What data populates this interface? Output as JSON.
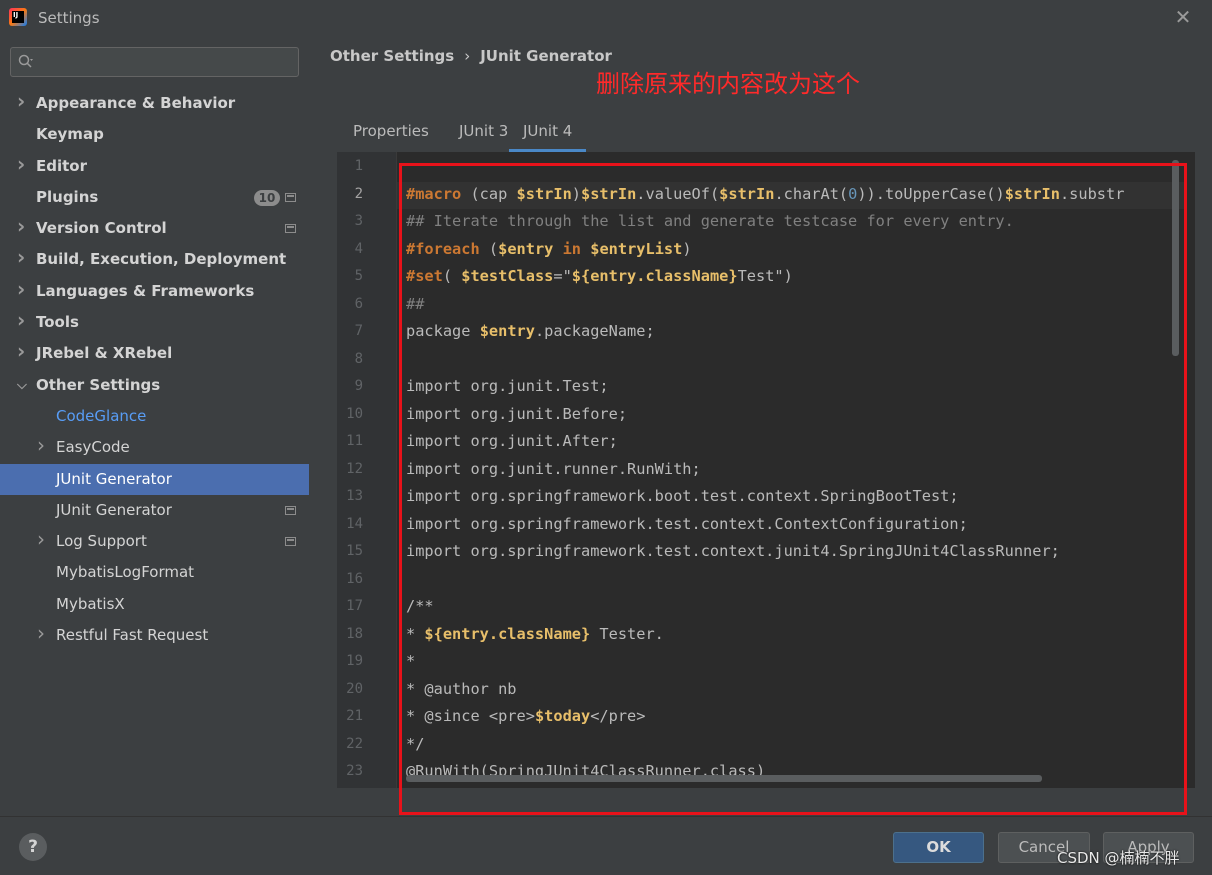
{
  "window": {
    "title": "Settings",
    "app_icon_text": "IJ"
  },
  "sidebar": {
    "search": {
      "placeholder": ""
    },
    "items": [
      {
        "label": "Appearance & Behavior",
        "bold": true,
        "expandable": true,
        "expanded": false,
        "indent": 0
      },
      {
        "label": "Keymap",
        "bold": true,
        "expandable": false,
        "indent": 0
      },
      {
        "label": "Editor",
        "bold": true,
        "expandable": true,
        "expanded": false,
        "indent": 0
      },
      {
        "label": "Plugins",
        "bold": true,
        "expandable": false,
        "indent": 0,
        "badge": "10",
        "project_icon": true
      },
      {
        "label": "Version Control",
        "bold": true,
        "expandable": true,
        "expanded": false,
        "indent": 0,
        "project_icon": true
      },
      {
        "label": "Build, Execution, Deployment",
        "bold": true,
        "expandable": true,
        "expanded": false,
        "indent": 0
      },
      {
        "label": "Languages & Frameworks",
        "bold": true,
        "expandable": true,
        "expanded": false,
        "indent": 0
      },
      {
        "label": "Tools",
        "bold": true,
        "expandable": true,
        "expanded": false,
        "indent": 0
      },
      {
        "label": "JRebel & XRebel",
        "bold": true,
        "expandable": true,
        "expanded": false,
        "indent": 0
      },
      {
        "label": "Other Settings",
        "bold": true,
        "expandable": true,
        "expanded": true,
        "indent": 0
      },
      {
        "label": "CodeGlance",
        "bold": false,
        "expandable": false,
        "indent": 1,
        "link": true
      },
      {
        "label": "EasyCode",
        "bold": false,
        "expandable": true,
        "expanded": false,
        "indent": 1
      },
      {
        "label": "JUnit Generator",
        "bold": false,
        "expandable": false,
        "indent": 1,
        "selected": true
      },
      {
        "label": "JUnit Generator",
        "bold": false,
        "expandable": false,
        "indent": 1,
        "project_icon": true
      },
      {
        "label": "Log Support",
        "bold": false,
        "expandable": true,
        "expanded": false,
        "indent": 1,
        "project_icon": true
      },
      {
        "label": "MybatisLogFormat",
        "bold": false,
        "expandable": false,
        "indent": 1
      },
      {
        "label": "MybatisX",
        "bold": false,
        "expandable": false,
        "indent": 1
      },
      {
        "label": "Restful Fast Request",
        "bold": false,
        "expandable": true,
        "expanded": false,
        "indent": 1
      }
    ]
  },
  "breadcrumb": {
    "parent": "Other Settings",
    "separator": "›",
    "current": "JUnit Generator"
  },
  "annotation": {
    "text": "删除原来的内容改为这个",
    "color": "#ff2a2a"
  },
  "tabs": [
    {
      "label": "Properties",
      "active": false
    },
    {
      "label": "JUnit 3",
      "active": false
    },
    {
      "label": "JUnit 4",
      "active": true
    }
  ],
  "editor": {
    "current_line": 2,
    "lines": [
      [],
      [
        [
          "kw",
          "#macro"
        ],
        [
          "t",
          " (cap "
        ],
        [
          "var",
          "$strIn"
        ],
        [
          "t",
          ")"
        ],
        [
          "var",
          "$strIn"
        ],
        [
          "t",
          ".valueOf("
        ],
        [
          "var",
          "$strIn"
        ],
        [
          "t",
          ".charAt("
        ],
        [
          "num",
          "0"
        ],
        [
          "t",
          ")).toUpperCase()"
        ],
        [
          "var",
          "$strIn"
        ],
        [
          "t",
          ".substr"
        ]
      ],
      [
        [
          "cm",
          "## Iterate through the list and generate testcase for every entry."
        ]
      ],
      [
        [
          "kw",
          "#foreach"
        ],
        [
          "t",
          " ("
        ],
        [
          "var",
          "$entry"
        ],
        [
          "t",
          " "
        ],
        [
          "kw",
          "in"
        ],
        [
          "t",
          " "
        ],
        [
          "var",
          "$entryList"
        ],
        [
          "t",
          ")"
        ]
      ],
      [
        [
          "kw",
          "#set"
        ],
        [
          "t",
          "( "
        ],
        [
          "var",
          "$testClass"
        ],
        [
          "t",
          "=\""
        ],
        [
          "var",
          "${entry.className}"
        ],
        [
          "t",
          "Test\")"
        ]
      ],
      [
        [
          "cm",
          "##"
        ]
      ],
      [
        [
          "t",
          "package "
        ],
        [
          "var",
          "$entry"
        ],
        [
          "t",
          ".packageName;"
        ]
      ],
      [],
      [
        [
          "t",
          "import org.junit.Test;"
        ]
      ],
      [
        [
          "t",
          "import org.junit.Before;"
        ]
      ],
      [
        [
          "t",
          "import org.junit.After;"
        ]
      ],
      [
        [
          "t",
          "import org.junit.runner.RunWith;"
        ]
      ],
      [
        [
          "t",
          "import org.springframework.boot.test.context.SpringBootTest;"
        ]
      ],
      [
        [
          "t",
          "import org.springframework.test.context.ContextConfiguration;"
        ]
      ],
      [
        [
          "t",
          "import org.springframework.test.context.junit4.SpringJUnit4ClassRunner;"
        ]
      ],
      [],
      [
        [
          "t",
          "/**"
        ]
      ],
      [
        [
          "t",
          "* "
        ],
        [
          "var",
          "${entry.className}"
        ],
        [
          "t",
          " Tester."
        ]
      ],
      [
        [
          "t",
          "*"
        ]
      ],
      [
        [
          "t",
          "* @author nb"
        ]
      ],
      [
        [
          "t",
          "* @since <pre>"
        ],
        [
          "var",
          "$today"
        ],
        [
          "t",
          "</pre>"
        ]
      ],
      [
        [
          "t",
          "*/"
        ]
      ],
      [
        [
          "t",
          "@RunWith(SpringJUnit4ClassRunner.class)"
        ]
      ]
    ]
  },
  "buttons": {
    "help": "?",
    "ok": "OK",
    "cancel": "Cancel",
    "apply": "Apply"
  },
  "watermark": "CSDN @楠楠不胖"
}
